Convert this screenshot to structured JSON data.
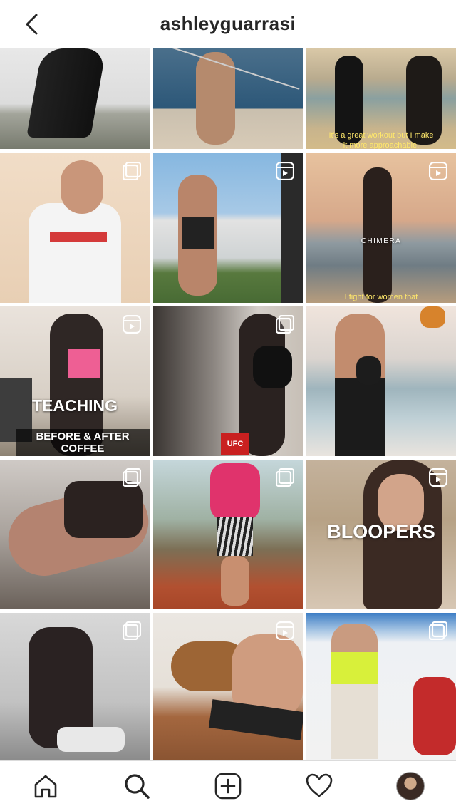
{
  "header": {
    "username": "ashleyguarrasi"
  },
  "posts": [
    {
      "type": "image",
      "caption_top": "",
      "caption_bottom": ""
    },
    {
      "type": "image",
      "caption_top": "",
      "caption_bottom": ""
    },
    {
      "type": "image",
      "caption_top": "It's a great workout but I make",
      "caption_bottom": "it more approachable."
    },
    {
      "type": "carousel",
      "caption_top": "",
      "caption_bottom": ""
    },
    {
      "type": "reel",
      "caption_top": "",
      "caption_bottom": ""
    },
    {
      "type": "reel",
      "caption_top": "CHIMERA",
      "caption_bottom": "I fight for women that"
    },
    {
      "type": "reel",
      "caption_top": "TEACHING",
      "caption_bottom": "BEFORE & AFTER COFFEE"
    },
    {
      "type": "carousel",
      "caption_top": "UFC",
      "caption_bottom": ""
    },
    {
      "type": "image",
      "caption_top": "",
      "caption_bottom": ""
    },
    {
      "type": "carousel",
      "caption_top": "",
      "caption_bottom": ""
    },
    {
      "type": "carousel",
      "caption_top": "",
      "caption_bottom": ""
    },
    {
      "type": "reel",
      "caption_top": "BLOOPERS",
      "caption_bottom": ""
    },
    {
      "type": "carousel",
      "caption_top": "",
      "caption_bottom": ""
    },
    {
      "type": "reel",
      "caption_top": "",
      "caption_bottom": ""
    },
    {
      "type": "carousel",
      "caption_top": "",
      "caption_bottom": ""
    }
  ],
  "nav": {
    "home": "home-icon",
    "search": "search-icon",
    "create": "plus-square-icon",
    "activity": "heart-icon",
    "profile": "avatar"
  }
}
